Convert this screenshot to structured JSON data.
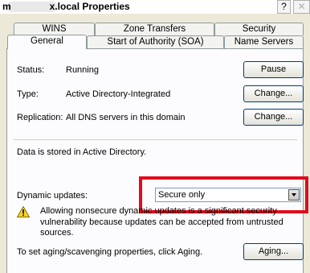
{
  "window": {
    "title": "m    x.local Properties",
    "help_label": "?",
    "close_label": "✕"
  },
  "tabs": {
    "row1": [
      "WINS",
      "Zone Transfers",
      "Security"
    ],
    "row2": [
      "General",
      "Start of Authority (SOA)",
      "Name Servers"
    ],
    "active": "General"
  },
  "general": {
    "status_label": "Status:",
    "status_value": "Running",
    "pause_button": "Pause",
    "type_label": "Type:",
    "type_value": "Active Directory-Integrated",
    "type_change_button": "Change...",
    "replication_label": "Replication:",
    "replication_value": "All DNS servers in this domain",
    "replication_change_button": "Change...",
    "storage_text": "Data is stored in Active Directory.",
    "dynamic_updates_label": "Dynamic updates:",
    "dynamic_updates_value": "Secure only",
    "warning_text": "Allowing nonsecure dynamic updates is a significant security vulnerability because updates can be accepted from untrusted sources.",
    "aging_text": "To set aging/scavenging properties, click Aging.",
    "aging_button": "Aging..."
  },
  "colors": {
    "highlight_box": "#e00c1c",
    "dialog_bg": "#ece9d8",
    "warning_icon": "#f6d22a"
  },
  "icons": {
    "warning": "warning-icon",
    "dropdown": "chevron-down-icon"
  }
}
